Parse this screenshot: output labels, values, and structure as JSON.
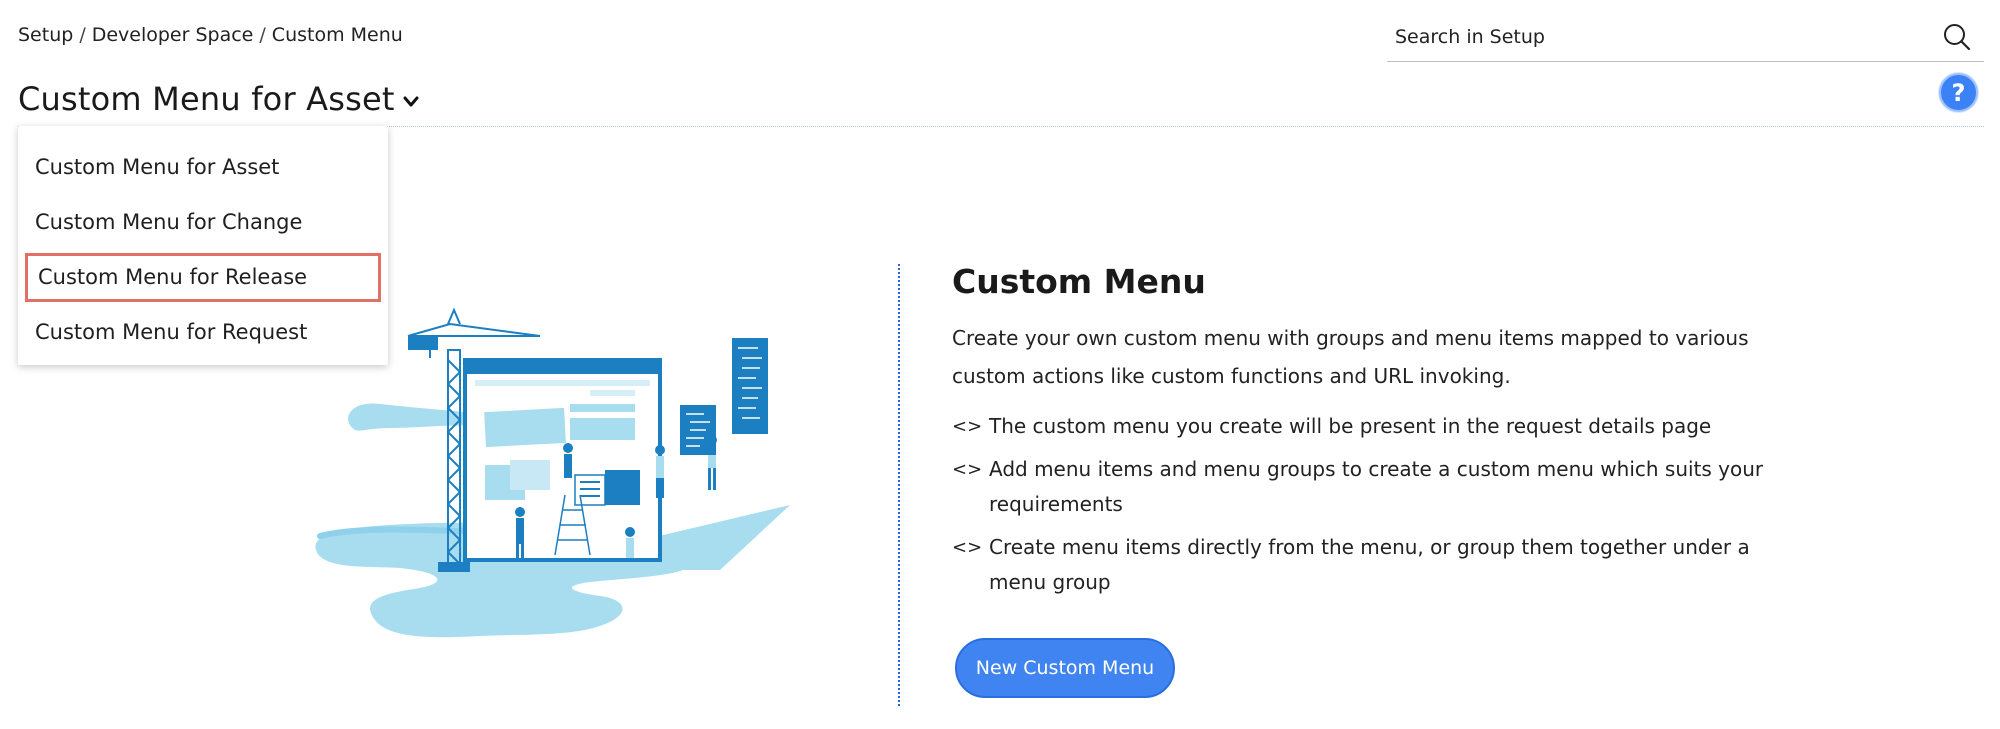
{
  "breadcrumb": {
    "items": [
      "Setup",
      "Developer Space",
      "Custom Menu"
    ],
    "separator": "/"
  },
  "search": {
    "placeholder": "Search in Setup",
    "icon": "search-icon"
  },
  "header": {
    "title": "Custom Menu for Asset",
    "help_label": "?"
  },
  "dropdown": {
    "items": [
      {
        "label": "Custom Menu for Asset"
      },
      {
        "label": "Custom Menu for Change"
      },
      {
        "label": "Custom Menu for Release",
        "highlighted": true
      },
      {
        "label": "Custom Menu for Request"
      }
    ]
  },
  "info": {
    "title": "Custom Menu",
    "description": "Create your own custom menu with groups and menu items mapped to various custom actions like custom functions and URL invoking.",
    "bullet_mark": "<>",
    "bullets": [
      "The custom menu you create will be present in the request details page",
      "Add menu items and menu groups to create a custom menu which suits your requirements",
      "Create menu items directly from the menu, or group them together under a menu group"
    ],
    "button_label": "New Custom Menu"
  },
  "colors": {
    "accent": "#3f84f0",
    "highlight_border": "#e07166",
    "illustration_light": "#a8dcef",
    "illustration_dark": "#1b7fc1"
  }
}
